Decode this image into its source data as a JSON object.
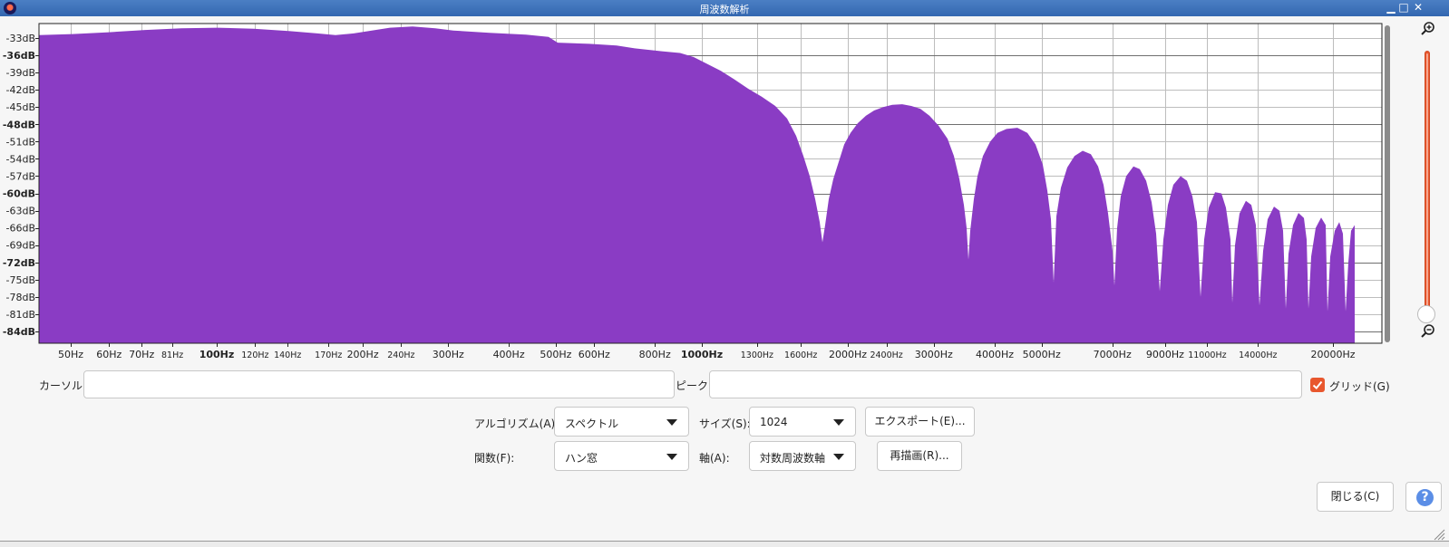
{
  "window": {
    "title": "周波数解析"
  },
  "plot": {
    "fill_color": "#8a3cc4",
    "y_ticks": [
      {
        "label": "-33dB",
        "value": -33,
        "bold": false
      },
      {
        "label": "-36dB",
        "value": -36,
        "bold": true
      },
      {
        "label": "-39dB",
        "value": -39,
        "bold": false
      },
      {
        "label": "-42dB",
        "value": -42,
        "bold": false
      },
      {
        "label": "-45dB",
        "value": -45,
        "bold": false
      },
      {
        "label": "-48dB",
        "value": -48,
        "bold": true
      },
      {
        "label": "-51dB",
        "value": -51,
        "bold": false
      },
      {
        "label": "-54dB",
        "value": -54,
        "bold": false
      },
      {
        "label": "-57dB",
        "value": -57,
        "bold": false
      },
      {
        "label": "-60dB",
        "value": -60,
        "bold": true
      },
      {
        "label": "-63dB",
        "value": -63,
        "bold": false
      },
      {
        "label": "-66dB",
        "value": -66,
        "bold": false
      },
      {
        "label": "-69dB",
        "value": -69,
        "bold": false
      },
      {
        "label": "-72dB",
        "value": -72,
        "bold": true
      },
      {
        "label": "-75dB",
        "value": -75,
        "bold": false
      },
      {
        "label": "-78dB",
        "value": -78,
        "bold": false
      },
      {
        "label": "-81dB",
        "value": -81,
        "bold": false
      },
      {
        "label": "-84dB",
        "value": -84,
        "bold": true
      }
    ],
    "x_ticks": [
      {
        "label": "50Hz",
        "value": 50,
        "size": "m",
        "bold": false
      },
      {
        "label": "60Hz",
        "value": 60,
        "size": "m",
        "bold": false
      },
      {
        "label": "70Hz",
        "value": 70,
        "size": "m",
        "bold": false
      },
      {
        "label": "81Hz",
        "value": 81,
        "size": "s",
        "bold": false
      },
      {
        "label": "100Hz",
        "value": 100,
        "size": "m",
        "bold": true
      },
      {
        "label": "120Hz",
        "value": 120,
        "size": "s",
        "bold": false
      },
      {
        "label": "140Hz",
        "value": 140,
        "size": "s",
        "bold": false
      },
      {
        "label": "170Hz",
        "value": 170,
        "size": "s",
        "bold": false
      },
      {
        "label": "200Hz",
        "value": 200,
        "size": "m",
        "bold": false
      },
      {
        "label": "240Hz",
        "value": 240,
        "size": "s",
        "bold": false
      },
      {
        "label": "300Hz",
        "value": 300,
        "size": "m",
        "bold": false
      },
      {
        "label": "400Hz",
        "value": 400,
        "size": "m",
        "bold": false
      },
      {
        "label": "500Hz",
        "value": 500,
        "size": "m",
        "bold": false
      },
      {
        "label": "600Hz",
        "value": 600,
        "size": "m",
        "bold": false
      },
      {
        "label": "800Hz",
        "value": 800,
        "size": "m",
        "bold": false
      },
      {
        "label": "1000Hz",
        "value": 1000,
        "size": "m",
        "bold": true
      },
      {
        "label": "1300Hz",
        "value": 1300,
        "size": "s",
        "bold": false
      },
      {
        "label": "1600Hz",
        "value": 1600,
        "size": "s",
        "bold": false
      },
      {
        "label": "2000Hz",
        "value": 2000,
        "size": "m",
        "bold": false
      },
      {
        "label": "2400Hz",
        "value": 2400,
        "size": "s",
        "bold": false
      },
      {
        "label": "3000Hz",
        "value": 3000,
        "size": "m",
        "bold": false
      },
      {
        "label": "4000Hz",
        "value": 4000,
        "size": "m",
        "bold": false
      },
      {
        "label": "5000Hz",
        "value": 5000,
        "size": "m",
        "bold": false
      },
      {
        "label": "7000Hz",
        "value": 7000,
        "size": "m",
        "bold": false
      },
      {
        "label": "9000Hz",
        "value": 9000,
        "size": "m",
        "bold": false
      },
      {
        "label": "11000Hz",
        "value": 11000,
        "size": "s",
        "bold": false
      },
      {
        "label": "14000Hz",
        "value": 14000,
        "size": "s",
        "bold": false
      },
      {
        "label": "20000Hz",
        "value": 20000,
        "size": "m",
        "bold": false
      }
    ],
    "spectrum": [
      [
        43,
        -32.5
      ],
      [
        80,
        -32.3
      ],
      [
        120,
        -32.0
      ],
      [
        160,
        -31.6
      ],
      [
        200,
        -31.3
      ],
      [
        240,
        -31.2
      ],
      [
        280,
        -31.4
      ],
      [
        320,
        -31.8
      ],
      [
        350,
        -32.2
      ],
      [
        370,
        -32.5
      ],
      [
        390,
        -32.2
      ],
      [
        410,
        -31.7
      ],
      [
        430,
        -31.2
      ],
      [
        455,
        -31.0
      ],
      [
        480,
        -31.3
      ],
      [
        500,
        -31.7
      ],
      [
        540,
        -32.1
      ],
      [
        580,
        -32.4
      ],
      [
        605,
        -32.8
      ],
      [
        615,
        -33.8
      ],
      [
        650,
        -34.0
      ],
      [
        680,
        -34.3
      ],
      [
        700,
        -34.8
      ],
      [
        730,
        -35.3
      ],
      [
        750,
        -35.6
      ],
      [
        765,
        -36.3
      ],
      [
        780,
        -37.5
      ],
      [
        795,
        -38.7
      ],
      [
        810,
        -40.2
      ],
      [
        825,
        -41.8
      ],
      [
        840,
        -43.2
      ],
      [
        855,
        -44.8
      ],
      [
        868,
        -47.0
      ],
      [
        878,
        -50.0
      ],
      [
        886,
        -53.5
      ],
      [
        893,
        -57.0
      ],
      [
        899,
        -61.0
      ],
      [
        904,
        -65.0
      ],
      [
        907,
        -68.5
      ],
      [
        910,
        -65.5
      ],
      [
        914,
        -61.0
      ],
      [
        919,
        -57.5
      ],
      [
        925,
        -54.5
      ],
      [
        931,
        -51.5
      ],
      [
        938,
        -49.5
      ],
      [
        946,
        -47.8
      ],
      [
        955,
        -46.5
      ],
      [
        964,
        -45.6
      ],
      [
        974,
        -45.0
      ],
      [
        984,
        -44.6
      ],
      [
        995,
        -44.5
      ],
      [
        1005,
        -44.8
      ],
      [
        1015,
        -45.3
      ],
      [
        1025,
        -46.5
      ],
      [
        1035,
        -48.2
      ],
      [
        1045,
        -50.5
      ],
      [
        1052,
        -53.5
      ],
      [
        1058,
        -57.5
      ],
      [
        1063,
        -62.0
      ],
      [
        1066,
        -66.0
      ],
      [
        1068,
        -71.5
      ],
      [
        1070,
        -66.5
      ],
      [
        1074,
        -61.0
      ],
      [
        1078,
        -57.0
      ],
      [
        1084,
        -53.5
      ],
      [
        1092,
        -51.0
      ],
      [
        1100,
        -49.5
      ],
      [
        1110,
        -48.8
      ],
      [
        1122,
        -48.6
      ],
      [
        1133,
        -49.5
      ],
      [
        1142,
        -51.5
      ],
      [
        1150,
        -55.0
      ],
      [
        1155,
        -59.5
      ],
      [
        1159,
        -64.5
      ],
      [
        1162,
        -75.5
      ],
      [
        1165,
        -64.0
      ],
      [
        1170,
        -59.0
      ],
      [
        1177,
        -55.5
      ],
      [
        1185,
        -53.5
      ],
      [
        1194,
        -52.6
      ],
      [
        1203,
        -53.2
      ],
      [
        1211,
        -55.3
      ],
      [
        1217,
        -58.5
      ],
      [
        1222,
        -63.5
      ],
      [
        1227,
        -70.0
      ],
      [
        1229,
        -76.0
      ],
      [
        1232,
        -66.0
      ],
      [
        1236,
        -60.5
      ],
      [
        1242,
        -57.0
      ],
      [
        1250,
        -55.3
      ],
      [
        1257,
        -55.8
      ],
      [
        1264,
        -57.8
      ],
      [
        1270,
        -61.5
      ],
      [
        1275,
        -67.0
      ],
      [
        1279,
        -77.0
      ],
      [
        1283,
        -68.0
      ],
      [
        1288,
        -62.0
      ],
      [
        1294,
        -58.5
      ],
      [
        1302,
        -57.0
      ],
      [
        1309,
        -57.8
      ],
      [
        1315,
        -60.5
      ],
      [
        1320,
        -65.0
      ],
      [
        1324,
        -78.0
      ],
      [
        1328,
        -68.0
      ],
      [
        1333,
        -62.5
      ],
      [
        1340,
        -59.8
      ],
      [
        1347,
        -60.0
      ],
      [
        1352,
        -62.5
      ],
      [
        1357,
        -68.0
      ],
      [
        1359,
        -79.0
      ],
      [
        1362,
        -69.0
      ],
      [
        1367,
        -63.5
      ],
      [
        1374,
        -61.3
      ],
      [
        1380,
        -62.0
      ],
      [
        1385,
        -65.5
      ],
      [
        1389,
        -79.5
      ],
      [
        1393,
        -70.0
      ],
      [
        1398,
        -64.5
      ],
      [
        1405,
        -62.3
      ],
      [
        1411,
        -63.0
      ],
      [
        1415,
        -66.5
      ],
      [
        1418,
        -80.0
      ],
      [
        1421,
        -70.5
      ],
      [
        1426,
        -65.5
      ],
      [
        1432,
        -63.4
      ],
      [
        1438,
        -64.3
      ],
      [
        1441,
        -68.0
      ],
      [
        1443,
        -80.0
      ],
      [
        1446,
        -71.0
      ],
      [
        1451,
        -66.0
      ],
      [
        1457,
        -64.2
      ],
      [
        1462,
        -65.5
      ],
      [
        1464,
        -80.5
      ],
      [
        1467,
        -71.0
      ],
      [
        1472,
        -66.5
      ],
      [
        1477,
        -65.0
      ],
      [
        1481,
        -67.0
      ],
      [
        1484,
        -80.5
      ],
      [
        1487,
        -72.0
      ],
      [
        1490,
        -66.5
      ],
      [
        1494,
        -65.5
      ]
    ]
  },
  "cursor": {
    "label": "カーソル:",
    "value": ""
  },
  "peak": {
    "label": "ピーク:",
    "value": ""
  },
  "grid": {
    "label": "グリッド(G)",
    "checked": true
  },
  "algorithm": {
    "label": "アルゴリズム(A):",
    "value": "スペクトル"
  },
  "size": {
    "label": "サイズ(S):",
    "value": "1024"
  },
  "export_label": "エクスポート(E)...",
  "function": {
    "label": "関数(F):",
    "value": "ハン窓"
  },
  "axis": {
    "label": "軸(A):",
    "value": "対数周波数軸"
  },
  "replot_label": "再描画(R)...",
  "close_label": "閉じる(C)",
  "help_symbol": "?",
  "accent_color": "#e8572e"
}
